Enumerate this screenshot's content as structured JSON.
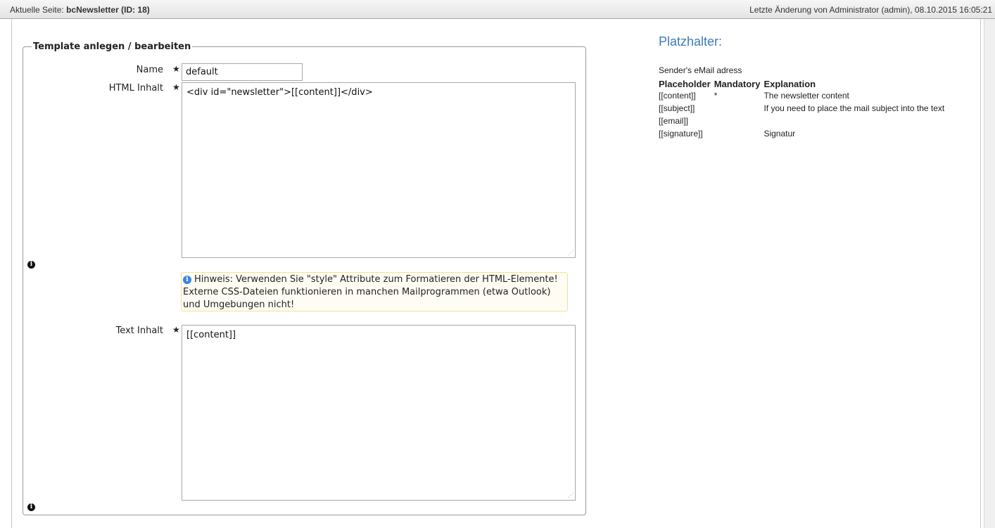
{
  "topbar": {
    "current_page_prefix": "Aktuelle Seite:",
    "current_page_name": "bcNewsletter",
    "current_page_id": "(ID: 18)",
    "last_change": "Letzte Änderung von Administrator (admin), 08.10.2015 16:05:21"
  },
  "form": {
    "legend": "Template anlegen / bearbeiten",
    "name_label": "Name",
    "name_value": "default",
    "html_label": "HTML Inhalt",
    "html_value": "<div id=\"newsletter\">[[content]]</div>",
    "hint_text": "Hinweis: Verwenden Sie \"style\" Attribute zum Formatieren der HTML-Elemente! Externe CSS-Dateien funktionieren in manchen Mailprogrammen (etwa Outlook) und Umgebungen nicht!",
    "text_label": "Text Inhalt",
    "text_value": "[[content]]",
    "required_icon": "star-icon",
    "info_icon": "info-icon",
    "resize_icon": "resize-grip-icon"
  },
  "placeholders": {
    "title": "Platzhalter:",
    "sender_text": "Sender's eMail adress",
    "headers": [
      "Placeholder",
      "Mandatory",
      "Explanation"
    ],
    "rows": [
      {
        "placeholder": "[[content]]",
        "mandatory": "*",
        "explanation": "The newsletter content"
      },
      {
        "placeholder": "[[subject]]",
        "mandatory": "",
        "explanation": "If you need to place the mail subject into the text"
      },
      {
        "placeholder": "[[email]]",
        "mandatory": "",
        "explanation": ""
      },
      {
        "placeholder": "[[signature]]",
        "mandatory": "",
        "explanation": "Signatur"
      }
    ]
  },
  "colors": {
    "accent": "#3d7ab8",
    "hint_border": "#f1e19a",
    "hint_bg": "#fffdf3",
    "hint_icon": "#3b86e0"
  }
}
